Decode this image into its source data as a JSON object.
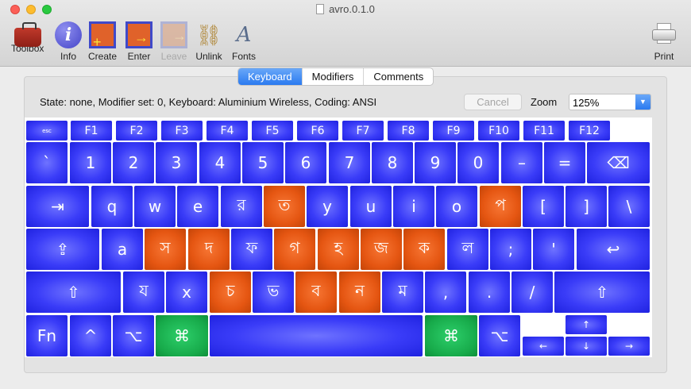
{
  "window": {
    "title": "avro.0.1.0"
  },
  "toolbar": {
    "items": [
      {
        "label": "Toolbox",
        "icon": "toolbox-icon",
        "enabled": true
      },
      {
        "label": "Info",
        "icon": "info-icon",
        "enabled": true
      },
      {
        "label": "Create",
        "icon": "create-icon",
        "enabled": true
      },
      {
        "label": "Enter",
        "icon": "enter-icon",
        "enabled": true
      },
      {
        "label": "Leave",
        "icon": "leave-icon",
        "enabled": false
      },
      {
        "label": "Unlink",
        "icon": "unlink-icon",
        "enabled": true
      },
      {
        "label": "Fonts",
        "icon": "fonts-icon",
        "enabled": true
      }
    ],
    "print_label": "Print"
  },
  "tabs": [
    {
      "label": "Keyboard",
      "active": true
    },
    {
      "label": "Modifiers",
      "active": false
    },
    {
      "label": "Comments",
      "active": false
    }
  ],
  "status": {
    "text": "State: none, Modifier set: 0, Keyboard: Aluminium Wireless, Coding: ANSI",
    "cancel_label": "Cancel",
    "zoom_label": "Zoom",
    "zoom_value": "125%"
  },
  "colors": {
    "key_blue": "#3a3cf8",
    "key_orange": "#e55612",
    "key_green": "#17aa4a",
    "tab_active": "#2a7af0"
  },
  "keyboard": {
    "fn_row": [
      "esc",
      "F1",
      "F2",
      "F3",
      "F4",
      "F5",
      "F6",
      "F7",
      "F8",
      "F9",
      "F10",
      "F11",
      "F12"
    ],
    "number_row": [
      "`",
      "1",
      "2",
      "3",
      "4",
      "5",
      "6",
      "7",
      "8",
      "9",
      "0",
      "–",
      "=",
      "⌫"
    ],
    "top_row": [
      "⇥",
      "q",
      "w",
      "e",
      "র",
      "ত",
      "y",
      "u",
      "i",
      "o",
      "প",
      "[",
      "]",
      "\\"
    ],
    "home_row": [
      "⇪",
      "a",
      "স",
      "দ",
      "ফ",
      "গ",
      "হ",
      "জ",
      "ক",
      "ল",
      ";",
      "'",
      "↩"
    ],
    "bottom_row": [
      "⇧",
      "য",
      "x",
      "চ",
      "ভ",
      "ব",
      "ন",
      "ম",
      ",",
      ".",
      "/",
      "⇧"
    ],
    "mod_row": [
      "Fn",
      "^",
      "⌥",
      "⌘",
      "",
      "⌘",
      "⌥"
    ],
    "arrows": [
      "↑",
      "←",
      "↓",
      "→"
    ]
  }
}
